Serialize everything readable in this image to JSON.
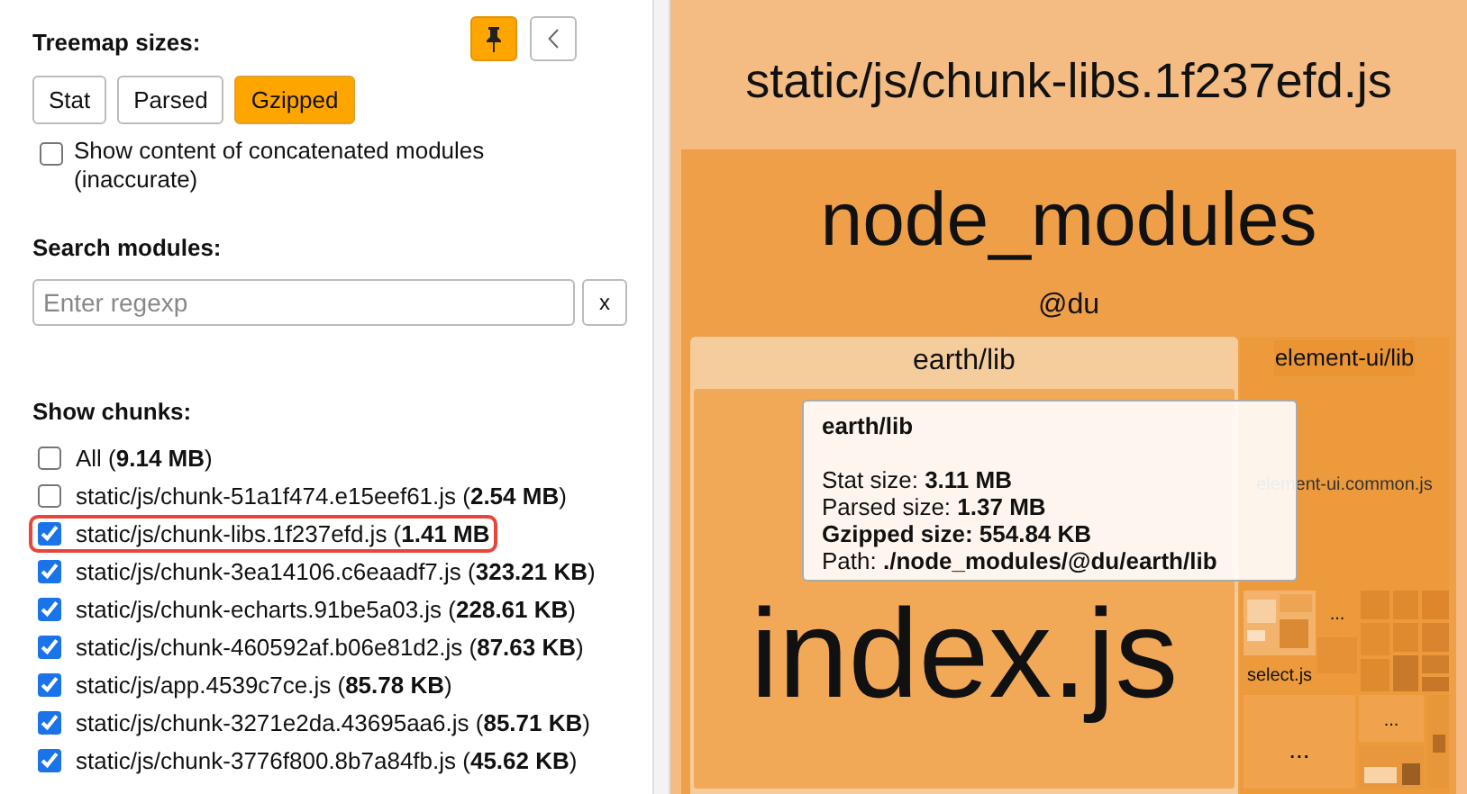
{
  "sidebar": {
    "pinned": true,
    "treemap_sizes": {
      "label": "Treemap sizes:",
      "options": [
        {
          "label": "Stat",
          "selected": false
        },
        {
          "label": "Parsed",
          "selected": false
        },
        {
          "label": "Gzipped",
          "selected": true
        }
      ]
    },
    "concatenated": {
      "label": "Show content of concatenated modules (inaccurate)",
      "checked": false
    },
    "search": {
      "label": "Search modules:",
      "placeholder": "Enter regexp",
      "clear": "x"
    },
    "chunks": {
      "label": "Show chunks:",
      "items": [
        {
          "label": "All (**9.14 MB**)",
          "checked": false,
          "highlighted": false
        },
        {
          "label": "static/js/chunk-51a1f474.e15eef61.js (**2.54 MB**)",
          "checked": false,
          "highlighted": false
        },
        {
          "label": "static/js/chunk-libs.1f237efd.js (**1.41 MB**",
          "checked": true,
          "highlighted": true
        },
        {
          "label": "static/js/chunk-3ea14106.c6eaadf7.js (**323.21 KB**)",
          "checked": true,
          "highlighted": false
        },
        {
          "label": "static/js/chunk-echarts.91be5a03.js (**228.61 KB**)",
          "checked": true,
          "highlighted": false
        },
        {
          "label": "static/js/chunk-460592af.b06e81d2.js (**87.63 KB**)",
          "checked": true,
          "highlighted": false
        },
        {
          "label": "static/js/app.4539c7ce.js (**85.78 KB**)",
          "checked": true,
          "highlighted": false
        },
        {
          "label": "static/js/chunk-3271e2da.43695aa6.js (**85.71 KB**)",
          "checked": true,
          "highlighted": false
        },
        {
          "label": "static/js/chunk-3776f800.8b7a84fb.js (**45.62 KB**)",
          "checked": true,
          "highlighted": false
        }
      ]
    }
  },
  "treemap": {
    "chunk": "static/js/chunk-libs.1f237efd.js",
    "group": "node_modules",
    "scope": "@du",
    "earth": {
      "title": "earth/lib",
      "module": "index.js"
    },
    "element": {
      "title": "element-ui/lib",
      "module": "element-ui.common.js",
      "cells": [
        {
          "label": "select.js"
        },
        {
          "label": "..."
        },
        {
          "label": "..."
        },
        {
          "label": "..."
        }
      ]
    }
  },
  "tooltip": {
    "title": "earth/lib",
    "lines": [
      {
        "text": "Stat size: **3.11 MB**",
        "bold": false
      },
      {
        "text": "Parsed size: **1.37 MB**",
        "bold": false
      },
      {
        "text": "Gzipped size: 554.84 KB",
        "bold": true
      },
      {
        "text": "Path: **./node_modules/@du/earth/lib**",
        "bold": false
      }
    ]
  }
}
